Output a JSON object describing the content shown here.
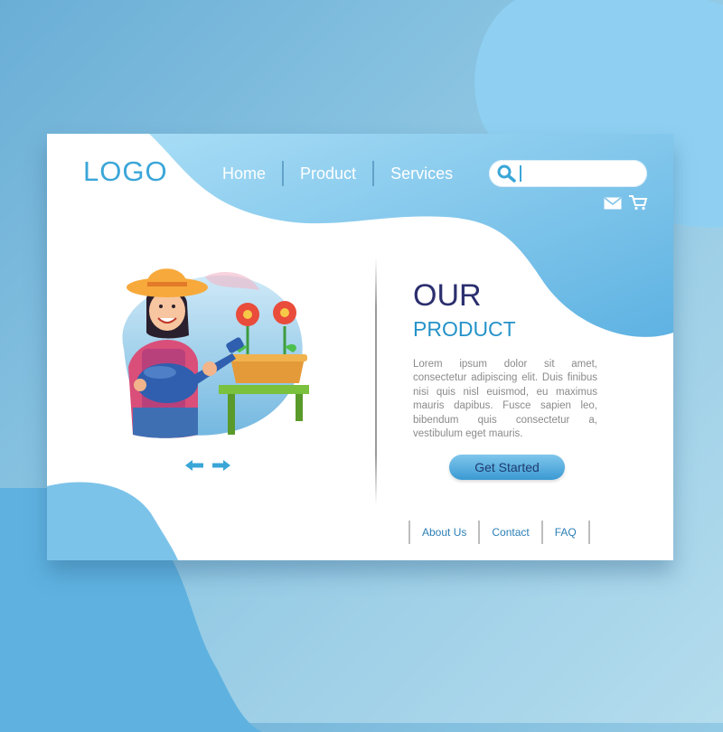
{
  "header": {
    "logo": "LOGO",
    "nav": [
      "Home",
      "Product",
      "Services"
    ],
    "search": {
      "value": "",
      "placeholder": ""
    },
    "icons": [
      "search-icon",
      "mail-icon",
      "cart-icon"
    ]
  },
  "hero": {
    "title": "OUR",
    "subtitle": "PRODUCT",
    "body": "Lorem ipsum dolor sit amet, consectetur adipiscing elit. Duis finibus nisi quis nisl euismod, eu maximus mauris dapibus. Fusce sapien leo, bibendum quis consectetur a, vestibulum eget mauris.",
    "cta_label": "Get Started"
  },
  "carousel": {
    "icons": [
      "arrow-left-icon",
      "arrow-right-icon"
    ]
  },
  "footer": {
    "links": [
      "About Us",
      "Contact",
      "FAQ"
    ]
  },
  "colors": {
    "accent": "#3aa6d8",
    "title": "#2b2f6e",
    "blob": "#7cc3ea",
    "button": "#4aa3d8"
  }
}
